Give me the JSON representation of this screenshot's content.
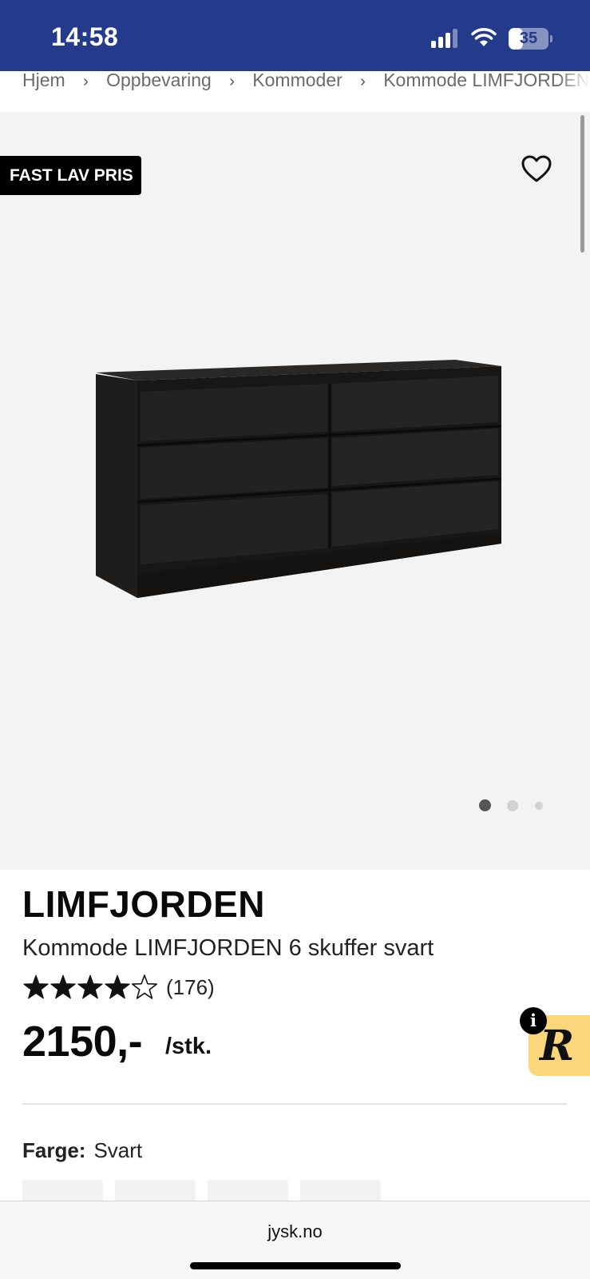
{
  "status_bar": {
    "time": "14:58",
    "battery_level": "35",
    "battery_fraction": 0.35,
    "icons": [
      "cellular-signal-icon",
      "wifi-icon",
      "battery-icon"
    ]
  },
  "breadcrumb": {
    "items": [
      "Hjem",
      "Oppbevaring",
      "Kommoder",
      "Kommode LIMFJORDEN"
    ],
    "separator": "›"
  },
  "gallery": {
    "badge": "FAST LAV PRIS",
    "wishlist_icon": "heart-outline-icon",
    "image_count": 3,
    "active_image": 1
  },
  "product": {
    "brand": "LIMFJORDEN",
    "name": "Kommode LIMFJORDEN 6 skuffer svart",
    "rating": 4,
    "rating_max": 5,
    "review_count": "(176)",
    "price": "2150,-",
    "unit": "/stk.",
    "color_label": "Farge:",
    "color_value": "Svart"
  },
  "widget": {
    "info_glyph": "i",
    "letter": "R"
  },
  "browser": {
    "url": "jysk.no"
  },
  "colors": {
    "header_blue": "#243a8a",
    "badge_black": "#000000",
    "widget_yellow": "#fbd67a",
    "gallery_bg": "#f3f3f3"
  }
}
